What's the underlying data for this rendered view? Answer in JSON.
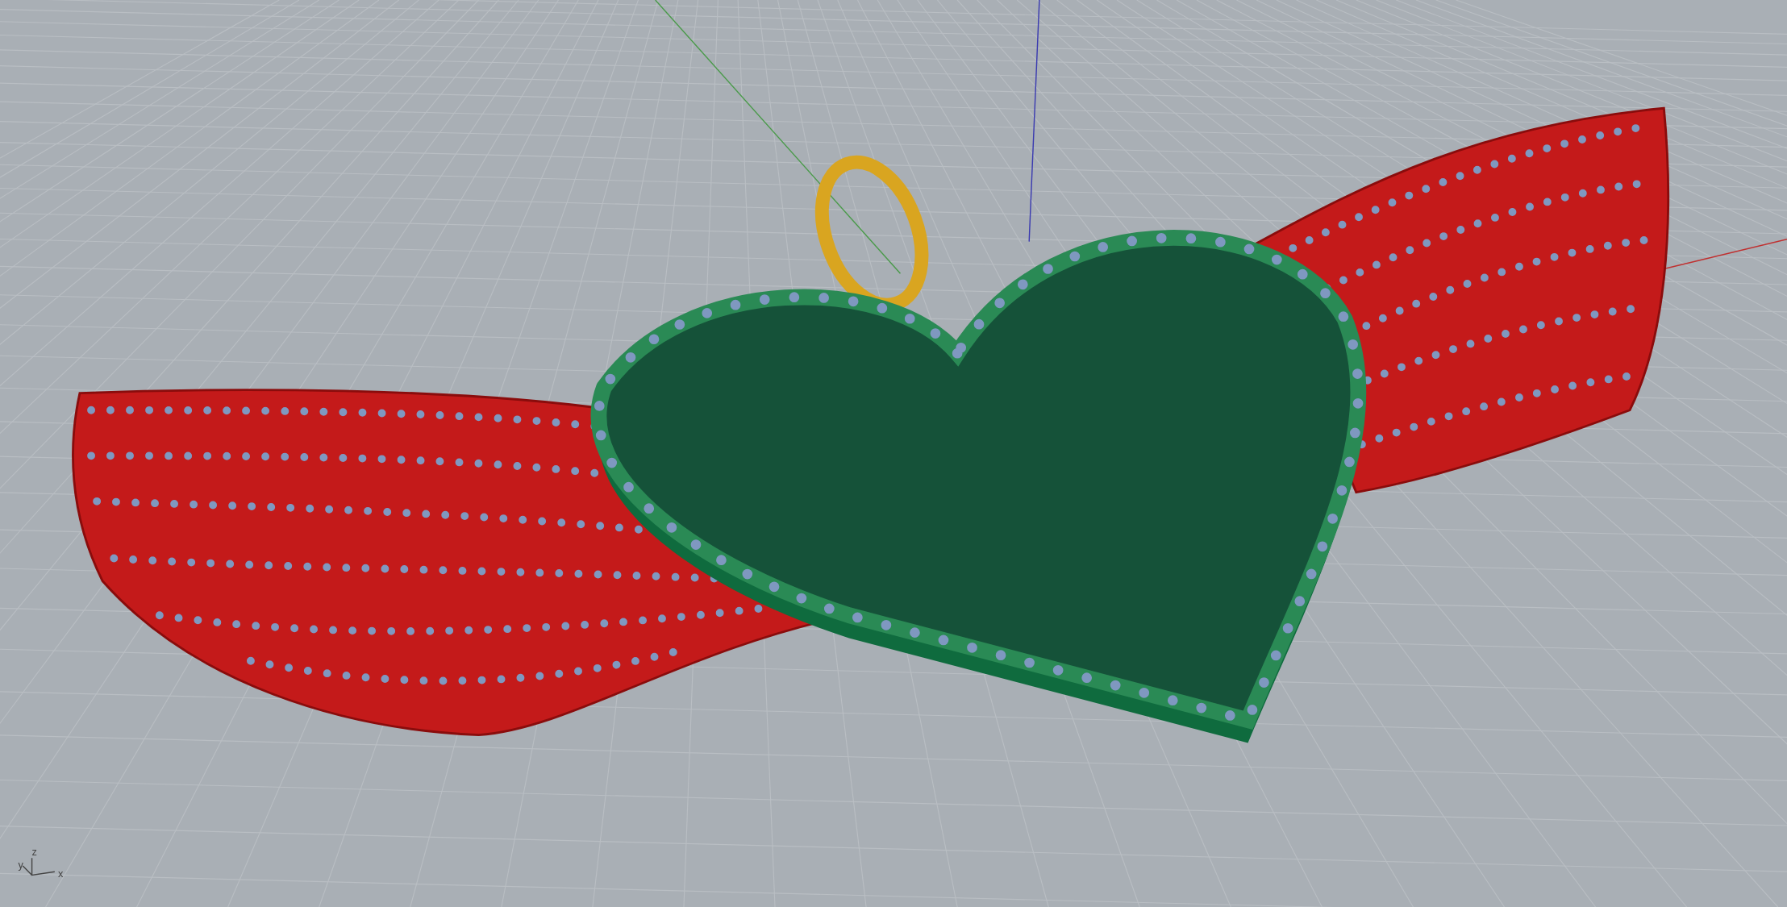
{
  "viewport": {
    "axis_gizmo": {
      "labels": [
        "z",
        "y",
        "x"
      ]
    }
  }
}
